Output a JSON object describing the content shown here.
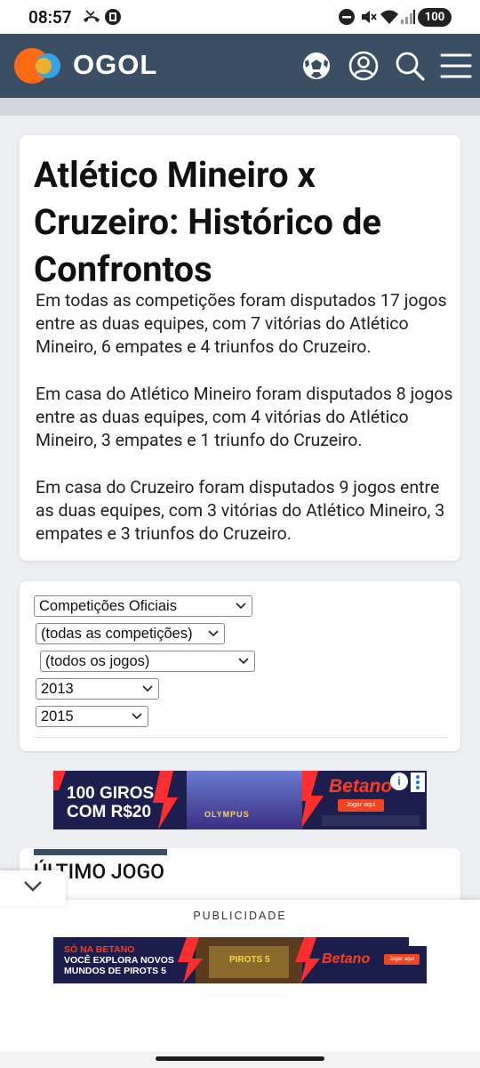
{
  "status_bar": {
    "time": "08:57",
    "battery": "100"
  },
  "header": {
    "logo_text": "OGOL",
    "brand_colors": {
      "header_bg": "#3a4f63",
      "logo_orange": "#ff6a13",
      "logo_blue": "#3aa3e8"
    },
    "icons": [
      "soccer-ball-icon",
      "user-icon",
      "search-icon",
      "menu-icon"
    ]
  },
  "summary": {
    "title": "Atlético Mineiro x Cruzeiro: Histórico de Confrontos",
    "paragraphs": [
      "Em todas as competições foram disputados 17 jogos entre as duas equipes, com 7 vitórias do Atlético Mineiro, 6 empates e 4 triunfos do Cruzeiro.",
      "Em casa do Atlético Mineiro foram disputados 8 jogos entre as duas equipes, com 4 vitórias do Atlético Mineiro, 3 empates e 1 triunfo do Cruzeiro.",
      "Em casa do Cruzeiro foram disputados 9 jogos entre as duas equipes, com 3 vitórias do Atlético Mineiro, 3 empates e 3 triunfos do Cruzeiro."
    ]
  },
  "filters": {
    "competition_type": "Competições Oficiais",
    "competition": "(todas as competições)",
    "games": "(todos os jogos)",
    "year_from": "2013",
    "year_to": "2015"
  },
  "ad_banner": {
    "headline_line1": "100 GIROS",
    "headline_line2": "COM R$20",
    "game_label": "OLYMPUS",
    "brand": "Betano",
    "button": "Jogar aqui",
    "info_icon": "i"
  },
  "last_game": {
    "heading": "ÚLTIMO JOGO"
  },
  "bottom_ad": {
    "label": "PUBLICIDADE",
    "line1": "SÓ NA BETANO",
    "line2": "VOCÊ EXPLORA NOVOS",
    "line3": "MUNDOS DE PIROTS 5",
    "game_label": "PIROTS 5",
    "brand": "Betano",
    "button": "Jogar aqui"
  }
}
